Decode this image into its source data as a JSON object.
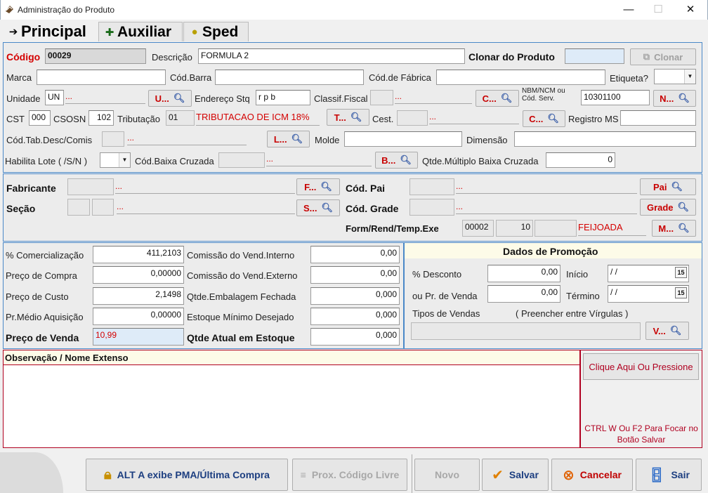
{
  "window": {
    "title": "Administração do Produto",
    "minimize": "—",
    "maximize": "☐",
    "close": "✕"
  },
  "tabs": [
    {
      "label": "Principal",
      "icon": "arrow-right-icon"
    },
    {
      "label": "Auxiliar",
      "icon": "plus-grid-icon"
    },
    {
      "label": "Sped",
      "icon": "coins-icon"
    }
  ],
  "top": {
    "codigo_label": "Código",
    "codigo_value": "00029",
    "descricao_label": "Descrição",
    "descricao_value": "FORMULA 2",
    "clonar_label": "Clonar do Produto",
    "clonar_button": "Clonar",
    "marca_label": "Marca",
    "codbarra_label": "Cód.Barra",
    "codfabrica_label": "Cód.de Fábrica",
    "etiqueta_label": "Etiqueta?",
    "unidade_label": "Unidade",
    "unidade_value": "UN",
    "dots": "...",
    "u_button": "U...",
    "endereco_label": "Endereço Stq",
    "endereco_value": "r p b",
    "classif_label": "Classif.Fiscal",
    "c_button": "C...",
    "nbm_label": "NBM/NCM ou Cód. Serv.",
    "nbm_value": "10301100",
    "n_button": "N...",
    "cst_label": "CST",
    "cst_value": "000",
    "csosn_label": "CSOSN",
    "csosn_value": "102",
    "tributacao_label": "Tributação",
    "tributacao_code": "01",
    "tributacao_desc": "TRIBUTACAO DE ICM 18%",
    "t_button": "T...",
    "cest_label": "Cest.",
    "cest_button": "C...",
    "registro_label": "Registro MS",
    "codtab_label": "Cód.Tab.Desc/Comis",
    "l_button": "L...",
    "molde_label": "Molde",
    "dimensao_label": "Dimensão",
    "lote_label": "Habilita Lote ( /S/N )",
    "baixa_label": "Cód.Baixa Cruzada",
    "b_button": "B...",
    "multiplo_label": "Qtde.Múltiplo Baixa Cruzada",
    "multiplo_value": "0"
  },
  "middle": {
    "fabricante_label": "Fabricante",
    "f_button": "F...",
    "secao_label": "Seção",
    "s_button": "S...",
    "codpai_label": "Cód. Pai",
    "pai_button": "Pai",
    "codgrade_label": "Cód. Grade",
    "grade_button": "Grade",
    "form_label": "Form/Rend/Temp.Exe",
    "form_code": "00002",
    "form_rend": "10",
    "form_desc": "FEIJOADA",
    "m_button": "M..."
  },
  "prices": {
    "comercializacao_label": "% Comercialização",
    "comercializacao_value": "411,2103",
    "compra_label": "Preço de Compra",
    "compra_value": "0,00000",
    "custo_label": "Preço de Custo",
    "custo_value": "2,1498",
    "medio_label": "Pr.Médio Aquisição",
    "medio_value": "0,00000",
    "venda_label": "Preço de Venda",
    "venda_value": "10,99",
    "com_interno_label": "Comissão do Vend.Interno",
    "com_interno_value": "0,00",
    "com_externo_label": "Comissão do Vend.Externo",
    "com_externo_value": "0,00",
    "embalagem_label": "Qtde.Embalagem Fechada",
    "embalagem_value": "0,000",
    "estoque_min_label": "Estoque Mínimo Desejado",
    "estoque_min_value": "0,000",
    "estoque_atual_label": "Qtde Atual em Estoque",
    "estoque_atual_value": "0,000"
  },
  "promo": {
    "title": "Dados de Promoção",
    "desconto_label": "% Desconto",
    "desconto_value": "0,00",
    "pr_venda_label": "ou  Pr. de Venda",
    "pr_venda_value": "0,00",
    "inicio_label": "Início",
    "inicio_value": "/ /",
    "termino_label": "Término",
    "termino_value": "/ /",
    "cal_text": "15",
    "tipos_label": "Tipos de Vendas",
    "tipos_hint": "( Preencher entre Vírgulas )",
    "v_button": "V..."
  },
  "obs": {
    "label": "Observação / Nome Extenso",
    "clique_button": "Clique Aqui Ou Pressione",
    "hint": "CTRL W Ou F2 Para Focar no Botão Salvar"
  },
  "footer": {
    "alt_button": "ALT A exibe PMA/Última Compra",
    "prox_button": "Prox. Código Livre",
    "novo_button": "Novo",
    "salvar_button": "Salvar",
    "cancelar_button": "Cancelar",
    "sair_button": "Sair"
  },
  "colors": {
    "accent_red": "#d40000",
    "panel_border": "#4a88c8",
    "obs_border": "#b00020"
  }
}
